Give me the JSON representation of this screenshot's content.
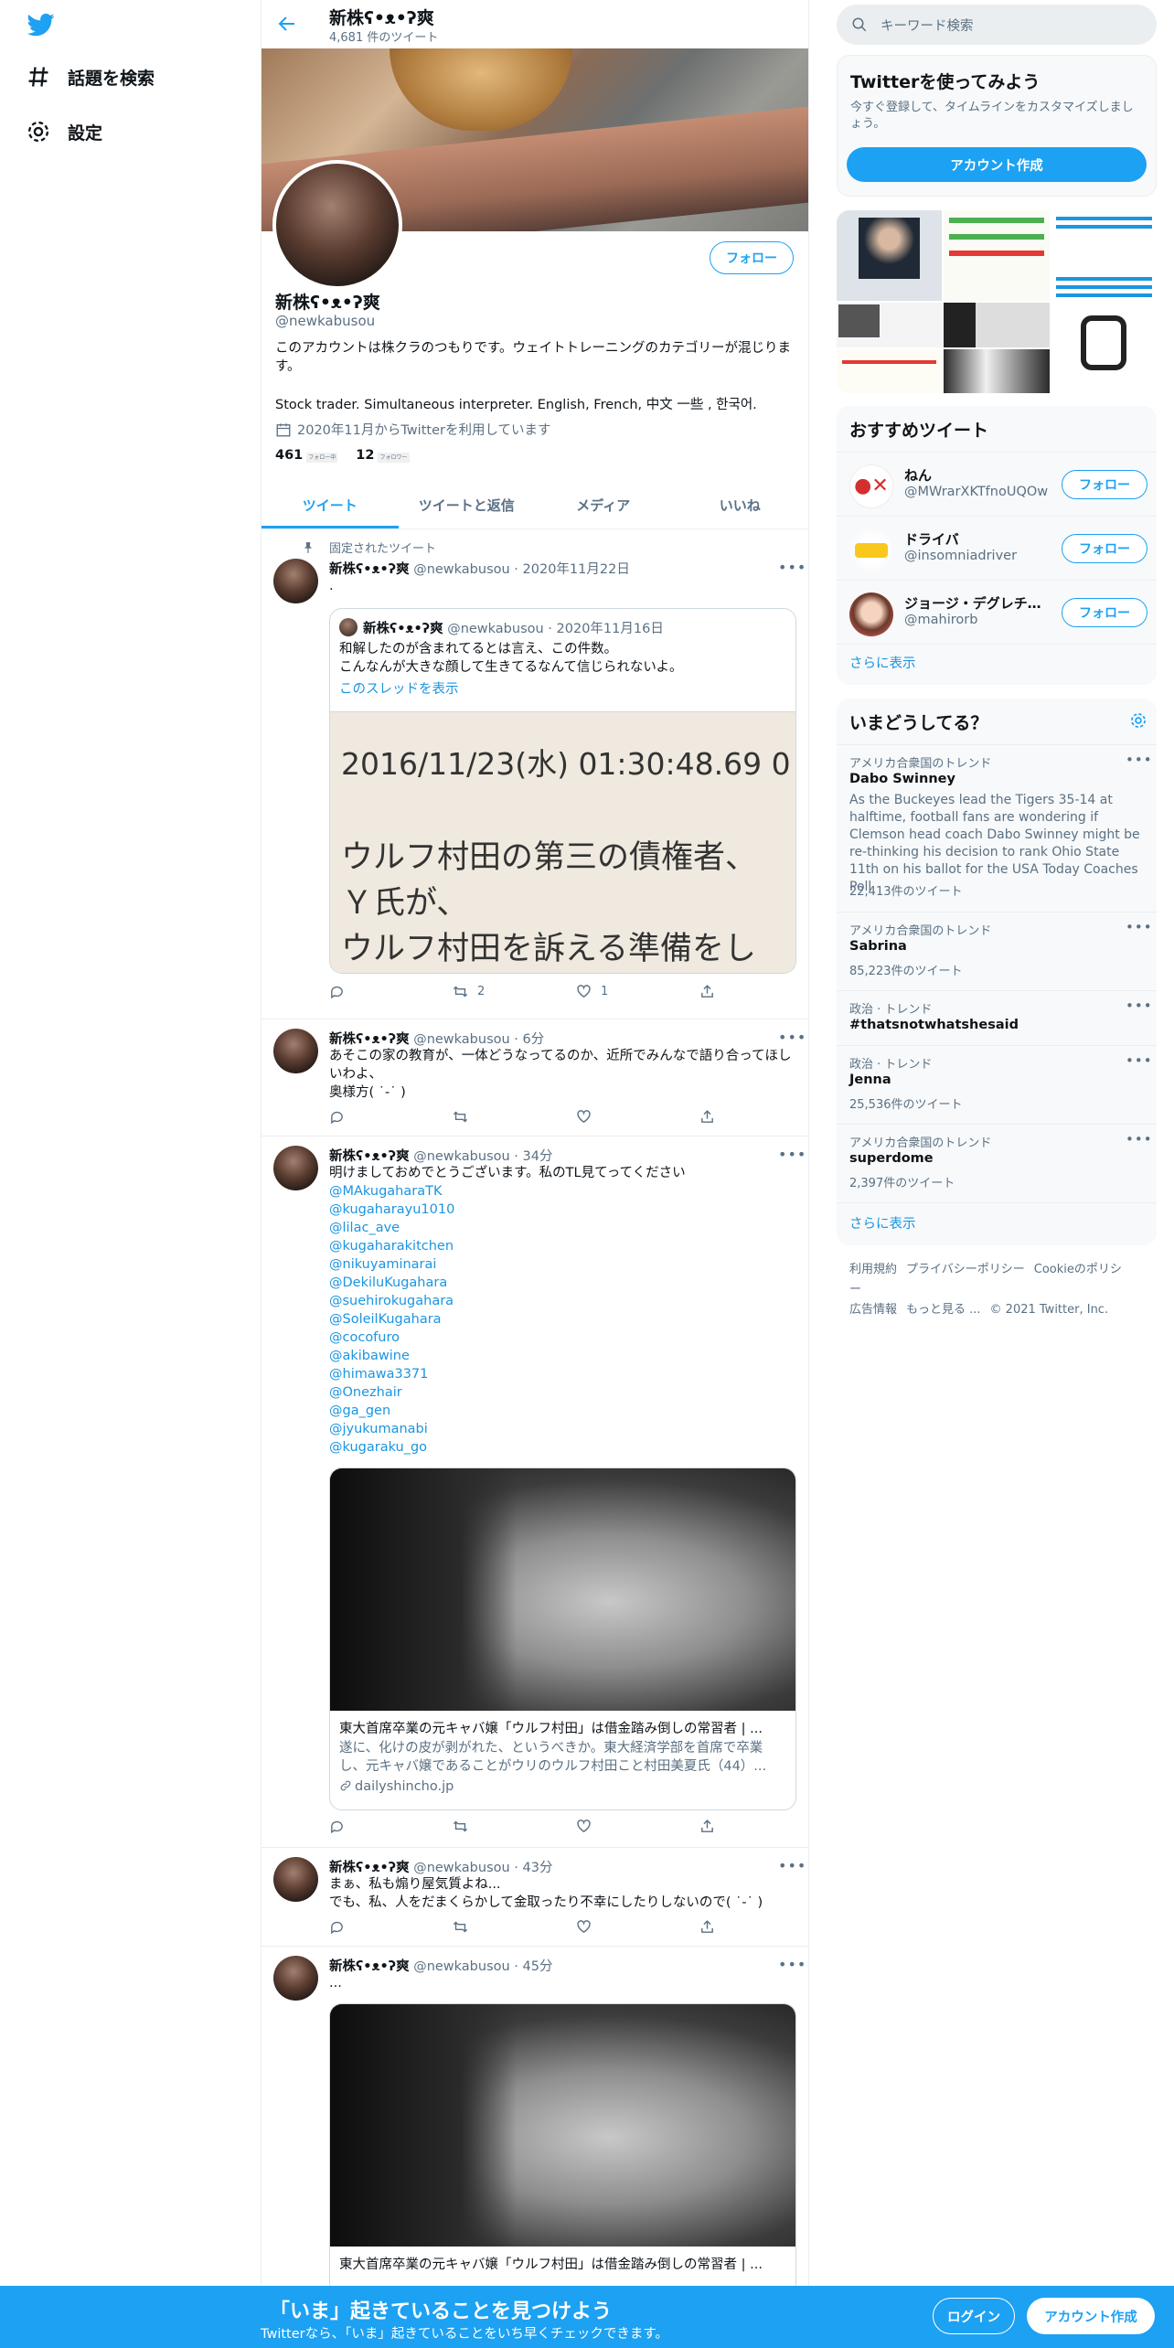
{
  "nav": {
    "explore_label": "話題を検索",
    "settings_label": "設定"
  },
  "header": {
    "title": "新株ʕ•ᴥ•ʔ爽",
    "subtitle": "4,681 件のツイート"
  },
  "profile": {
    "name": "新株ʕ•ᴥ•ʔ爽",
    "handle": "@newkabusou",
    "follow_label": "フォロー",
    "bio_line1": "このアカウントは株クラのつもりです。ウェイトトレーニングのカテゴリーが混じります。",
    "bio_line2": "Stock trader. Simultaneous interpreter. English, French, 中文 一些 , 한국어.",
    "joined": "2020年11月からTwitterを利用しています",
    "following_count": "461",
    "following_label": "フォロー中",
    "followers_count": "12",
    "followers_label": "フォロワー"
  },
  "tabs": [
    "ツイート",
    "ツイートと返信",
    "メディア",
    "いいね"
  ],
  "tweets": {
    "t1": {
      "pinned_label": "固定されたツイート",
      "name": "新株ʕ•ᴥ•ʔ爽",
      "meta": "@newkabusou · 2020年11月22日",
      "text": ".",
      "quote": {
        "name": "新株ʕ•ᴥ•ʔ爽",
        "meta": "@newkabusou · 2020年11月16日",
        "text": "和解したのが含まれてるとは言え、この件数。\nこんなんが大きな顔して生きてるなんて信じられないよ。",
        "thread_link": "このスレッドを表示",
        "image_line1": "2016/11/23(水) 01:30:48.69 0",
        "image_line2": "ウルフ村田の第三の債権者、",
        "image_line3": "Ｙ氏が、",
        "image_line4": "ウルフ村田を訴える準備をし"
      },
      "retweets": "2",
      "likes": "1"
    },
    "t2": {
      "name": "新株ʕ•ᴥ•ʔ爽",
      "meta": "@newkabusou · 6分",
      "text": "あそこの家の教育が、一体どうなってるのか、近所でみんなで語り合ってほしいわよ、\n奥様方( ˙-˙ )"
    },
    "t3": {
      "name": "新株ʕ•ᴥ•ʔ爽",
      "meta": "@newkabusou · 34分",
      "text": "明けましておめでとうございます。私のTL見てってください",
      "mentions": [
        "@MAkugaharaTK",
        "@kugaharayu1010",
        "@lilac_ave",
        "@kugaharakitchen",
        "@nikuyaminarai",
        "@DekiluKugahara",
        "@suehirokugahara",
        "@SoleilKugahara",
        "@cocofuro",
        "@akibawine",
        "@himawa3371",
        "@Onezhair",
        "@ga_gen",
        "@jyukumanabi",
        "@kugaraku_go"
      ],
      "card_title": "東大首席卒業の元キャバ嬢「ウルフ村田」は借金踏み倒しの常習者 | ...",
      "card_desc": "遂に、化けの皮が剥がれた、というべきか。東大経済学部を首席で卒業し、元キャバ嬢であることがウリのウルフ村田こと村田美夏氏（44）...",
      "card_domain": "dailyshincho.jp"
    },
    "t4": {
      "name": "新株ʕ•ᴥ•ʔ爽",
      "meta": "@newkabusou · 43分",
      "text": "まぁ、私も煽り屋気質よね...\nでも、私、人をだまくらかして金取ったり不幸にしたりしないので( ˙-˙ )"
    },
    "t5": {
      "name": "新株ʕ•ᴥ•ʔ爽",
      "meta": "@newkabusou · 45分",
      "text": "...",
      "card_title": "東大首席卒業の元キャバ嬢「ウルフ村田」は借金踏み倒しの常習者 | ..."
    }
  },
  "right": {
    "search_placeholder": "キーワード検索",
    "signup": {
      "title": "Twitterを使ってみよう",
      "desc": "今すぐ登録して、タイムラインをカスタマイズしましょう。",
      "button": "アカウント作成"
    },
    "recommend": {
      "title": "おすすめツイート",
      "users": [
        {
          "name": "ねん",
          "handle": "@MWrarXKTfnoUQOw",
          "follow": "フォロー"
        },
        {
          "name": "ドライバ",
          "handle": "@insomniadriver",
          "follow": "フォロー"
        },
        {
          "name": "ジョージ・デグレチャフ",
          "handle": "@mahirorb",
          "follow": "フォロー"
        }
      ],
      "more": "さらに表示"
    },
    "trends": {
      "title": "いまどうしてる？",
      "items": [
        {
          "category": "アメリカ合衆国のトレンド",
          "name": "Dabo Swinney",
          "desc": "As the Buckeyes lead the Tigers 35-14 at halftime, football fans are wondering if Clemson head coach Dabo Swinney might be re-thinking his decision to rank Ohio State 11th on his ballot for the USA Today Coaches Poll",
          "count": "22,413件のツイート"
        },
        {
          "category": "アメリカ合衆国のトレンド",
          "name": "Sabrina",
          "count": "85,223件のツイート"
        },
        {
          "category": "政治 · トレンド",
          "name": "#thatsnotwhatshesaid"
        },
        {
          "category": "政治 · トレンド",
          "name": "Jenna",
          "count": "25,536件のツイート"
        },
        {
          "category": "アメリカ合衆国のトレンド",
          "name": "superdome",
          "count": "2,397件のツイート"
        }
      ],
      "more": "さらに表示"
    },
    "footer": {
      "terms": "利用規約",
      "privacy": "プライバシーポリシー",
      "cookie": "Cookieのポリシー",
      "ads": "広告情報",
      "more": "もっと見る ...",
      "copyright": "© 2021 Twitter, Inc."
    }
  },
  "bottombar": {
    "title": "「いま」起きていることを見つけよう",
    "subtitle": "Twitterなら、「いま」起きていることをいち早くチェックできます。",
    "login": "ログイン",
    "signup": "アカウント作成"
  },
  "colors": {
    "accent": "#1da1f2",
    "link": "#1b95e0",
    "secondary_text": "#5b7083"
  }
}
